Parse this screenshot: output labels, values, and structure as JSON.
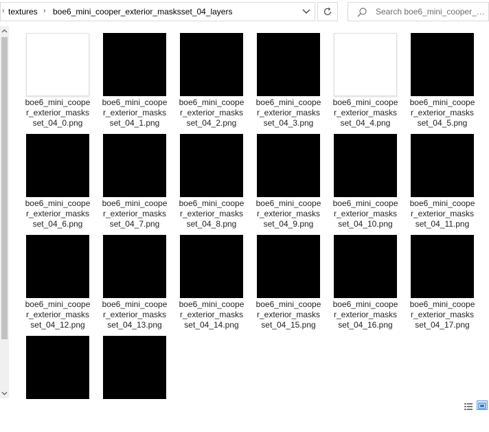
{
  "address_bar": {
    "breadcrumbs": [
      "textures",
      "boe6_mini_cooper_exterior_masksset_04_layers"
    ],
    "separator_icon": "chevron-right-icon",
    "dropdown_icon": "chevron-down-icon",
    "refresh_icon": "refresh-icon"
  },
  "search": {
    "placeholder": "Search boe6_mini_cooper_e..."
  },
  "files": [
    {
      "name": "boe6_mini_cooper_exterior_masksset_04_0.png",
      "thumb": "white"
    },
    {
      "name": "boe6_mini_cooper_exterior_masksset_04_1.png",
      "thumb": "black"
    },
    {
      "name": "boe6_mini_cooper_exterior_masksset_04_2.png",
      "thumb": "black"
    },
    {
      "name": "boe6_mini_cooper_exterior_masksset_04_3.png",
      "thumb": "black"
    },
    {
      "name": "boe6_mini_cooper_exterior_masksset_04_4.png",
      "thumb": "white"
    },
    {
      "name": "boe6_mini_cooper_exterior_masksset_04_5.png",
      "thumb": "black"
    },
    {
      "name": "boe6_mini_cooper_exterior_masksset_04_6.png",
      "thumb": "black"
    },
    {
      "name": "boe6_mini_cooper_exterior_masksset_04_7.png",
      "thumb": "black"
    },
    {
      "name": "boe6_mini_cooper_exterior_masksset_04_8.png",
      "thumb": "black"
    },
    {
      "name": "boe6_mini_cooper_exterior_masksset_04_9.png",
      "thumb": "black"
    },
    {
      "name": "boe6_mini_cooper_exterior_masksset_04_10.png",
      "thumb": "black"
    },
    {
      "name": "boe6_mini_cooper_exterior_masksset_04_11.png",
      "thumb": "black"
    },
    {
      "name": "boe6_mini_cooper_exterior_masksset_04_12.png",
      "thumb": "black"
    },
    {
      "name": "boe6_mini_cooper_exterior_masksset_04_13.png",
      "thumb": "black"
    },
    {
      "name": "boe6_mini_cooper_exterior_masksset_04_14.png",
      "thumb": "black"
    },
    {
      "name": "boe6_mini_cooper_exterior_masksset_04_15.png",
      "thumb": "black"
    },
    {
      "name": "boe6_mini_cooper_exterior_masksset_04_16.png",
      "thumb": "black"
    },
    {
      "name": "boe6_mini_cooper_exterior_masksset_04_17.png",
      "thumb": "black"
    },
    {
      "name": "",
      "thumb": "black"
    },
    {
      "name": "",
      "thumb": "black"
    }
  ],
  "view_toggles": {
    "details_icon": "details-view-icon",
    "large_icons_icon": "large-icons-view-icon",
    "selected": "large-icons"
  }
}
